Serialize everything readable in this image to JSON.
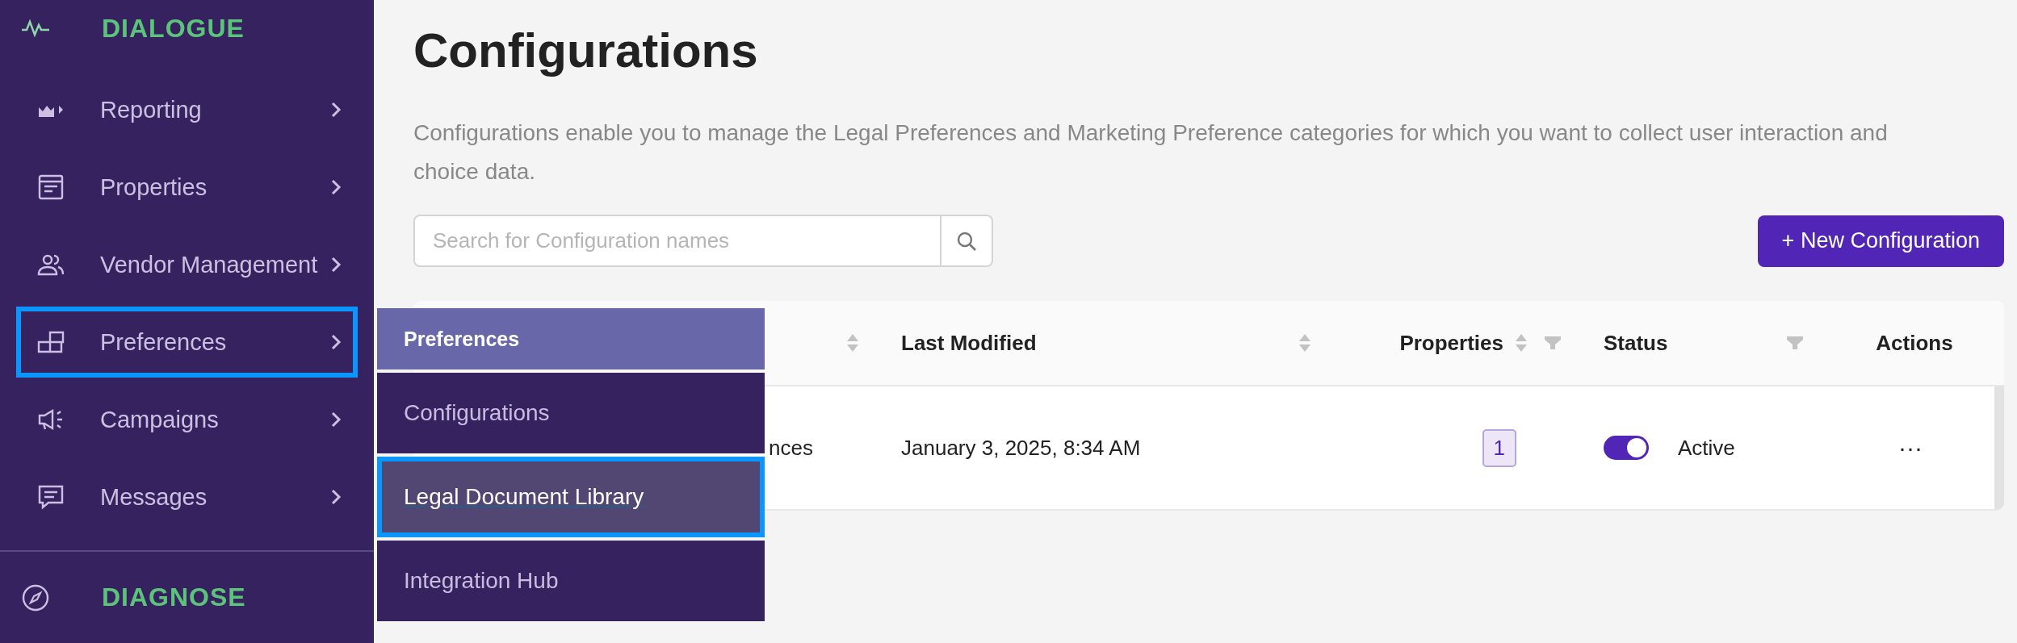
{
  "sidebar": {
    "header": {
      "title": "DIALOGUE"
    },
    "items": [
      {
        "label": "Reporting",
        "selected": false
      },
      {
        "label": "Properties",
        "selected": false
      },
      {
        "label": "Vendor Management",
        "selected": false
      },
      {
        "label": "Preferences",
        "selected": true
      },
      {
        "label": "Campaigns",
        "selected": false
      },
      {
        "label": "Messages",
        "selected": false
      }
    ],
    "footer": {
      "title": "DIAGNOSE"
    }
  },
  "flyout": {
    "title": "Preferences",
    "items": [
      {
        "label": "Configurations",
        "selected": false
      },
      {
        "label": "Legal Document Library",
        "selected": true
      },
      {
        "label": "Integration Hub",
        "selected": false
      }
    ]
  },
  "page": {
    "title": "Configurations",
    "description": "Configurations enable you to manage the Legal Preferences and Marketing Preference categories for which you want to collect user interaction and choice data.",
    "search": {
      "placeholder": "Search for Configuration names"
    },
    "new_button": "+ New Configuration"
  },
  "table": {
    "columns": [
      {
        "sortable": true,
        "filterable": false
      },
      {
        "label": "Last Modified",
        "sortable": true,
        "filterable": false
      },
      {
        "label": "Properties",
        "sortable": true,
        "filterable": true
      },
      {
        "label": "Status",
        "sortable": false,
        "filterable": true
      },
      {
        "label": "Actions",
        "sortable": false,
        "filterable": false
      }
    ],
    "rows": [
      {
        "column_1": "nces",
        "last_modified": "January 3, 2025, 8:34 AM",
        "properties": "1",
        "status": {
          "on": true,
          "label": "Active"
        },
        "actions": "···"
      }
    ]
  }
}
